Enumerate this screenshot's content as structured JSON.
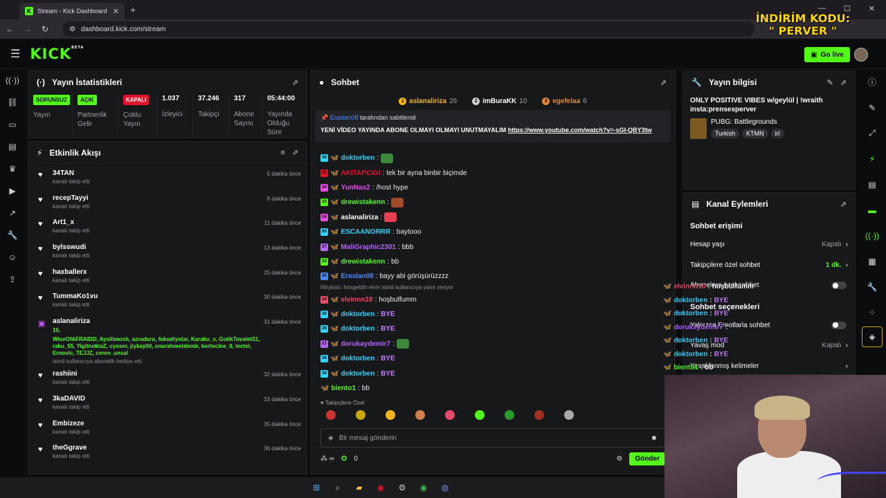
{
  "browser": {
    "tab_title": "Stream - Kick Dashboard",
    "url": "dashboard.kick.com/stream",
    "promo_line1": "İNDİRİM KODU:",
    "promo_line2": "\" PERVER \""
  },
  "header": {
    "logo": "KICK",
    "logo_beta": "BETA",
    "go_live": "Go live"
  },
  "stats": {
    "title": "Yayın İstatistikleri",
    "items": [
      {
        "pill": "SORUNSUZ",
        "pill_color": "#53fc18",
        "label": "Yayın"
      },
      {
        "pill": "AÇIK",
        "pill_color": "#53fc18",
        "label": "Partnerlik Gelir"
      },
      {
        "pill": "KAPALI",
        "pill_color": "#e4112a",
        "label": "Çoklu Yayın"
      },
      {
        "value": "1.037",
        "label": "İzleyici"
      },
      {
        "value": "37.246",
        "label": "Takipçi"
      },
      {
        "value": "317",
        "label": "Abone Sayısı"
      },
      {
        "value": "05:44:00",
        "label": "Yayında Olduğu Süre"
      }
    ]
  },
  "activity": {
    "title": "Etkinlik Akışı",
    "follow_text": "kanalı takip etti",
    "items": [
      {
        "name": "34TAN",
        "time": "5 dakika önce"
      },
      {
        "name": "recepTayyi",
        "time": "6 dakika önce"
      },
      {
        "name": "Art1_x",
        "time": "11 dakika önce"
      },
      {
        "name": "bylsswudi",
        "time": "13 dakika önce"
      },
      {
        "name": "haxballerx",
        "time": "25 dakika önce"
      },
      {
        "name": "TummaKo1vu",
        "time": "30 dakika önce"
      }
    ],
    "gift": {
      "name": "aslanaliriza",
      "time": "31 dakika önce",
      "count": "16,",
      "users": "WiseOfAFRAIDD, Aysilimosh, azraduru, fukodiyolar, Karaku_s, GotikTuvalet31, raku_55, YigitnoktaZ, cyoser, jiykay00, onurahmetdemir, bortecine_0, tectel, Ernovic, TEJJZ, ceren_unsal",
      "text": "isimli kullanıcıya abonelik hediye etti."
    },
    "items2": [
      {
        "name": "rashiini",
        "time": "32 dakika önce"
      },
      {
        "name": "3kaDAVID",
        "time": "33 dakika önce"
      },
      {
        "name": "Embizeze",
        "time": "35 dakika önce"
      },
      {
        "name": "theGgrave",
        "time": "36 dakika önce"
      }
    ]
  },
  "chat": {
    "title": "Sohbet",
    "leaders": [
      {
        "rank": "1",
        "name": "aslanaliriza",
        "count": "26",
        "color": "#f5b51b"
      },
      {
        "rank": "2",
        "name": "imBuraKK",
        "count": "10",
        "color": "#d0d0d0"
      },
      {
        "rank": "3",
        "name": "egefelaa",
        "count": "6",
        "color": "#e08a3a"
      }
    ],
    "pinned_by": "Eraslan08",
    "pinned_by_suffix": "tarafından sabitlendi",
    "pinned_msg": "YENİ VİDEO YAYINDA ABONE OLMAYI OLMAYI UNUTMAYALIM",
    "pinned_link": "https://www.youtube.com/watch?v=-sGI-QBY3tw",
    "messages": [
      {
        "badge": "36",
        "user": "doktorben",
        "color": "#33d3ff",
        "text": "",
        "emote": "#3a8a3a"
      },
      {
        "badge": "30",
        "user": "AKITAPCIGI",
        "color": "#e4112a",
        "text": "tek bir ayna binbir biçimde"
      },
      {
        "badge": "24",
        "user": "YunNas2",
        "color": "#e94ae9",
        "text": "/host hype"
      },
      {
        "badge": "33",
        "user": "drewistakenn",
        "color": "#53fc18",
        "text": "",
        "emote": "#a04a2a"
      },
      {
        "badge": "24",
        "user": "aslanaliriza",
        "color": "#ffffff",
        "text": "",
        "emote": "#e84050"
      },
      {
        "badge": "60",
        "user": "ESCAANORRR",
        "color": "#33d3ff",
        "text": "baytooo"
      },
      {
        "badge": "37",
        "user": "MaliGraphic2301",
        "color": "#b266ff",
        "text": "bbb"
      },
      {
        "badge": "33",
        "user": "drewistakenn",
        "color": "#53fc18",
        "text": "bb"
      },
      {
        "badge": "33",
        "user": "Eraslan08",
        "color": "#4d88ff",
        "text": "bayy abi görüşürüzzzz"
      }
    ],
    "reply_note": "f4irykiss: hosgeldin elvin isimli kullanıcıya yanıt veriyor",
    "messages2": [
      {
        "badge": "14",
        "user": "elvinnn10",
        "color": "#e94a6a",
        "text": "hoşbulfumm"
      },
      {
        "badge": "36",
        "user": "doktorben",
        "color": "#33d3ff",
        "text": "BYE"
      },
      {
        "badge": "36",
        "user": "doktorben",
        "color": "#33d3ff",
        "text": "BYE"
      },
      {
        "badge": "21",
        "user": "dorukaydemir7",
        "color": "#b266ff",
        "text": "",
        "emote": "#3a8a3a"
      },
      {
        "badge": "36",
        "user": "doktorben",
        "color": "#33d3ff",
        "text": "BYE"
      },
      {
        "badge": "36",
        "user": "doktorben",
        "color": "#33d3ff",
        "text": "BYE"
      },
      {
        "badge": "",
        "user": "biento1",
        "color": "#53fc18",
        "text": "bb"
      }
    ],
    "followers_label": "Takipçilere Özel",
    "input_placeholder": "Bir mesaj gönderin",
    "bottom_count": "0",
    "send": "Gönder"
  },
  "info": {
    "title": "Yayın bilgisi",
    "stream_title": "ONLY POSITIVE VIBES w/geylül | !wraith insta:prensesperver",
    "game": "PUBG: Battlegrounds",
    "tags": [
      "Turkish",
      "KTMN",
      "irl"
    ]
  },
  "actions": {
    "title": "Kanal Eylemleri",
    "section1": "Sohbet erişimi",
    "opts": [
      {
        "label": "Hesap yaşı",
        "value": "Kapalı"
      },
      {
        "label": "Takipçilere özel sohbet",
        "value": "1 dk."
      },
      {
        "label": "Abonelere özel sohbet"
      }
    ],
    "section2": "Sohbet seçenekleri",
    "opts2": [
      {
        "label": "Yalnızca Emotlarla sohbet"
      },
      {
        "label": "Yavaş mod",
        "value": "Kapalı"
      },
      {
        "label": "Yasaklanmış kelimeler"
      }
    ]
  },
  "overlay": [
    {
      "user": "elvinnn10",
      "color": "#e94a6a",
      "text": "hoşbulfumm"
    },
    {
      "user": "doktorben",
      "color": "#33d3ff",
      "text": "BYE"
    },
    {
      "user": "doktorben",
      "color": "#33d3ff",
      "text": "BYE"
    },
    {
      "user": "dorukaydemir7",
      "color": "#b266ff",
      "text": ""
    },
    {
      "user": "doktorben",
      "color": "#33d3ff",
      "text": "BYE"
    },
    {
      "user": "doktorben",
      "color": "#33d3ff",
      "text": "BYE"
    },
    {
      "user": "biento1",
      "color": "#53fc18",
      "text": "bb"
    }
  ]
}
